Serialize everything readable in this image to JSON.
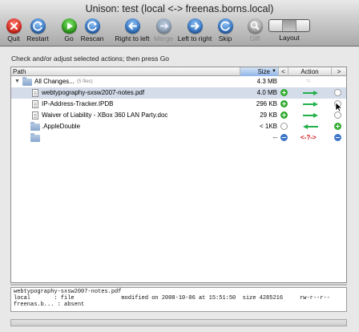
{
  "window": {
    "title": "Unison: test (local <-> freenas.borns.local)"
  },
  "toolbar": {
    "quit": "Quit",
    "restart": "Restart",
    "go": "Go",
    "rescan": "Rescan",
    "right_to_left": "Right to left",
    "merge": "Merge",
    "left_to_right": "Left to right",
    "skip": "Skip",
    "diff": "Diff",
    "layout": "Layout"
  },
  "instruction": "Check and/or adjust selected actions; then press Go",
  "table": {
    "headers": {
      "path": "Path",
      "size": "Size",
      "prev": "<",
      "action": "Action",
      "next": ">"
    },
    "rows": [
      {
        "name": "All Changes...",
        "extra": "(5 files)",
        "size": "4.3 MB",
        "kind": "root-folder"
      },
      {
        "name": "webtypography-sxsw2007-notes.pdf",
        "size": "4.0 MB",
        "kind": "file",
        "selected": true
      },
      {
        "name": "IP-Address-Tracker.IPDB",
        "size": "296 KB",
        "kind": "file"
      },
      {
        "name": "Waiver of Liability - XBox 360 LAN Party.doc",
        "size": "29 KB",
        "kind": "file"
      },
      {
        "name": ".AppleDouble",
        "size": "< 1KB",
        "kind": "folder"
      },
      {
        "name": "",
        "size": "--",
        "kind": "folder",
        "conflict": "<-?->"
      }
    ]
  },
  "details": {
    "line1": "webtypography-sxsw2007-notes.pdf",
    "line2": "local       : file              modified on 2008-10-06 at 15:51:50  size 4285216     rw-r--r--",
    "line3": "freenas.b... : absent"
  },
  "colors": {
    "accent_green": "#22b04b",
    "conflict_red": "#d01010",
    "selection": "#d4dcea"
  }
}
